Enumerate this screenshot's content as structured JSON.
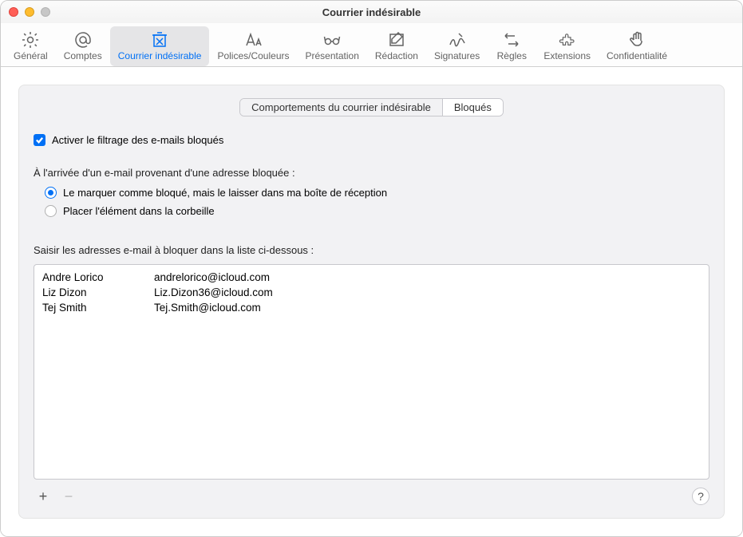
{
  "window": {
    "title": "Courrier indésirable"
  },
  "toolbar": {
    "items": [
      {
        "label": "Général"
      },
      {
        "label": "Comptes"
      },
      {
        "label": "Courrier indésirable"
      },
      {
        "label": "Polices/Couleurs"
      },
      {
        "label": "Présentation"
      },
      {
        "label": "Rédaction"
      },
      {
        "label": "Signatures"
      },
      {
        "label": "Règles"
      },
      {
        "label": "Extensions"
      },
      {
        "label": "Confidentialité"
      }
    ]
  },
  "segmented": {
    "tab1": "Comportements du courrier indésirable",
    "tab2": "Bloqués"
  },
  "enable_filter_label": "Activer le filtrage des e-mails bloqués",
  "arrival_label": "À l'arrivée d'un e-mail provenant d'une adresse bloquée :",
  "radios": {
    "mark": "Le marquer comme bloqué, mais le laisser dans ma boîte de réception",
    "trash": "Placer l'élément dans la corbeille"
  },
  "list_instruction": "Saisir les adresses e-mail à bloquer dans la liste ci-dessous :",
  "blocked": [
    {
      "name": "Andre Lorico",
      "email": "andrelorico@icloud.com"
    },
    {
      "name": "Liz Dizon",
      "email": "Liz.Dizon36@icloud.com"
    },
    {
      "name": "Tej Smith",
      "email": "Tej.Smith@icloud.com"
    }
  ],
  "buttons": {
    "add": "+",
    "remove": "−",
    "help": "?"
  }
}
